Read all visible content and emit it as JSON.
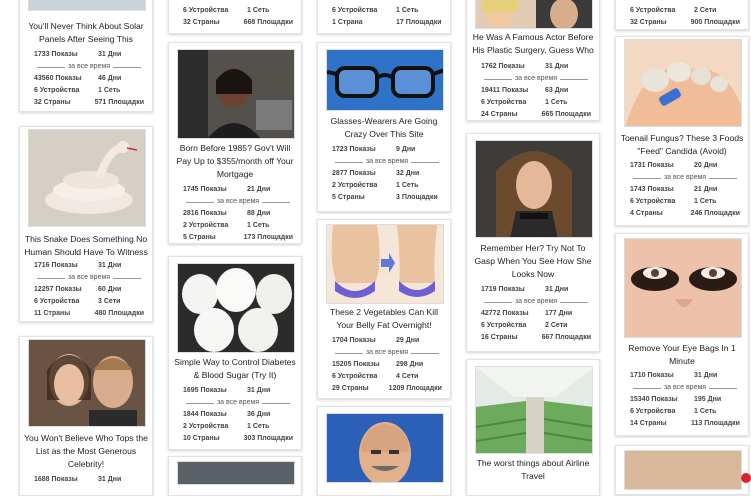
{
  "sep_label": "за все время",
  "cards": {
    "c1a": {
      "title": "",
      "stats": {
        "impr": "",
        "days": "",
        "impr_all": "",
        "net_all": "",
        "dev": "6 Устройства",
        "net": "1 Сеть",
        "countries": "32 Страны",
        "sites": "668 Площадки"
      }
    },
    "c1b": {
      "title": "Born Before 1985? Gov't Will Pay Up to $355/month off Your Mortgage",
      "stats": {
        "impr": "1745 Показы",
        "days": "21 Дни",
        "impr_all": "2816 Показы",
        "days_all": "88 Дни",
        "dev": "2 Устройства",
        "net": "1 Сеть",
        "countries": "5 Страны",
        "sites": "173 Площадки"
      }
    },
    "c1c": {
      "title": "Simple Way to Control Diabetes & Blood Sugar (Try It)",
      "stats": {
        "impr": "1695 Показы",
        "days": "31 Дни",
        "impr_all": "1844 Показы",
        "days_all": "36 Дни",
        "dev": "2 Устройства",
        "net": "1 Сеть",
        "countries": "10 Страны",
        "sites": "303 Площадки"
      }
    },
    "c0a": {
      "title": "You'll Never Think About Solar Panels After Seeing This",
      "stats": {
        "impr": "1733 Показы",
        "days": "31 Дни",
        "impr_all": "43560 Показы",
        "days_all": "46 Дни",
        "dev": "6 Устройства",
        "net": "1 Сеть",
        "countries": "32 Страны",
        "sites": "571 Площадки"
      }
    },
    "c0b": {
      "title": "This Snake Does Something No Human Should Have To Witness",
      "stats": {
        "impr": "1716 Показы",
        "days": "31 Дни",
        "impr_all": "12257 Показы",
        "days_all": "60 Дни",
        "dev": "6 Устройства",
        "net": "3 Сети",
        "countries": "11 Страны",
        "sites": "480 Площадки"
      }
    },
    "c0c": {
      "title": "You Won't Believe Who Tops the List as the Most Generous Celebrity!",
      "stats": {
        "impr": "1688 Показы",
        "days": "31 Дни"
      }
    },
    "c2a": {
      "title": "",
      "stats": {
        "dev": "6 Устройства",
        "net": "1 Сеть",
        "countries": "1 Страна",
        "sites": "17 Площадки"
      }
    },
    "c2b": {
      "title": "Glasses-Wearers Are Going Crazy Over This Site",
      "stats": {
        "impr": "1723 Показы",
        "days": "9 Дни",
        "impr_all": "2877 Показы",
        "days_all": "32 Дни",
        "dev": "2 Устройства",
        "net": "1 Сеть",
        "countries": "5 Страны",
        "sites": "3 Площадки"
      }
    },
    "c2c": {
      "title": "These 2 Vegetables Can Kill Your Belly Fat Overnight!",
      "stats": {
        "impr": "1704 Показы",
        "days": "29 Дни",
        "impr_all": "15205 Показы",
        "days_all": "298 Дни",
        "dev": "6 Устройства",
        "net": "4 Сети",
        "countries": "29 Страны",
        "sites": "1209 Площадки"
      }
    },
    "c3a": {
      "title": "He Was A Famous Actor Before His Plastic Surgery, Guess Who",
      "stats": {
        "impr": "1762 Показы",
        "days": "31 Дни",
        "impr_all": "19411 Показы",
        "days_all": "63 Дни",
        "dev": "6 Устройства",
        "net": "1 Сеть",
        "countries": "24 Страны",
        "sites": "665 Площадки"
      }
    },
    "c3b": {
      "title": "Remember Her? Try Not To Gasp When You See How She Looks Now",
      "stats": {
        "impr": "1719 Показы",
        "days": "31 Дни",
        "impr_all": "42772 Показы",
        "days_all": "177 Дни",
        "dev": "6 Устройства",
        "net": "2 Сети",
        "countries": "16 Страны",
        "sites": "667 Площадки"
      }
    },
    "c3c": {
      "title": "The worst things about Airline Travel",
      "stats": {}
    },
    "c4a": {
      "title": "",
      "stats": {
        "dev": "6 Устройства",
        "net": "2 Сети",
        "countries": "32 Страны",
        "sites": "900 Площадки"
      }
    },
    "c4b": {
      "title": "Toenail Fungus? These 3 Foods \"Feed\" Candida (Avoid)",
      "stats": {
        "impr": "1731 Показы",
        "days": "20 Дни",
        "impr_all": "1743 Показы",
        "days_all": "21 Дни",
        "dev": "6 Устройства",
        "net": "1 Сеть",
        "countries": "4 Страны",
        "sites": "246 Площадки"
      }
    },
    "c4c": {
      "title": "Remove Your Eye Bags In 1 Minute",
      "stats": {
        "impr": "1710 Показы",
        "days": "31 Дни",
        "impr_all": "15340 Показы",
        "days_all": "195 Дни",
        "dev": "6 Устройства",
        "net": "1 Сеть",
        "countries": "14 Страны",
        "sites": "113 Площадки"
      }
    }
  }
}
